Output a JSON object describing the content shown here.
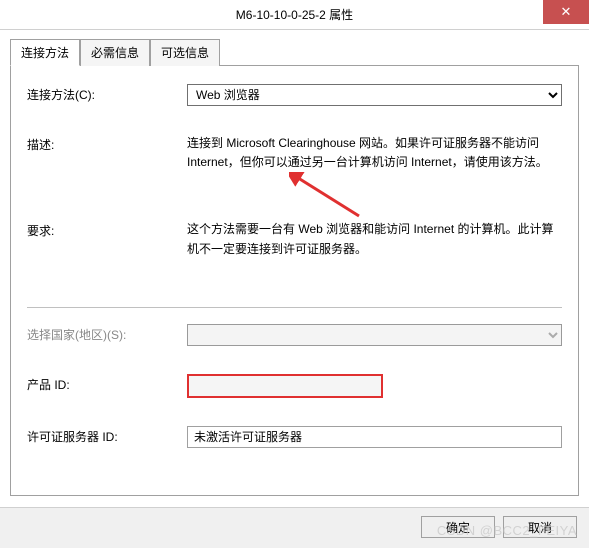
{
  "window": {
    "title": "M6-10-10-0-25-2 属性",
    "close_symbol": "✕"
  },
  "tabs": {
    "tab1": "连接方法",
    "tab2": "必需信息",
    "tab3": "可选信息"
  },
  "form": {
    "connection_method_label": "连接方法(C):",
    "connection_method_value": "Web 浏览器",
    "description_label": "描述:",
    "description_text": "连接到 Microsoft Clearinghouse 网站。如果许可证服务器不能访问 Internet，但你可以通过另一台计算机访问 Internet，请使用该方法。",
    "requirements_label": "要求:",
    "requirements_text": "这个方法需要一台有 Web 浏览器和能访问 Internet 的计算机。此计算机不一定要连接到许可证服务器。",
    "country_label": "选择国家(地区)(S):",
    "country_value": "",
    "product_id_label": "产品 ID:",
    "product_id_value": "",
    "license_server_id_label": "许可证服务器 ID:",
    "license_server_id_value": "未激活许可证服务器"
  },
  "buttons": {
    "ok": "确定",
    "cancel": "取消"
  },
  "watermark": "CSDN @BCC2_FEIYA"
}
